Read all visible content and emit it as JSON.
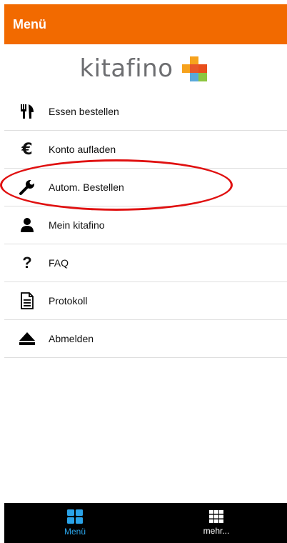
{
  "header": {
    "title": "Menü"
  },
  "logo": {
    "text": "kitafino"
  },
  "menu": {
    "items": [
      {
        "label": "Essen bestellen",
        "icon": "cutlery-icon"
      },
      {
        "label": "Konto aufladen",
        "icon": "euro-icon"
      },
      {
        "label": "Autom. Bestellen",
        "icon": "wrench-icon"
      },
      {
        "label": "Mein kitafino",
        "icon": "user-icon"
      },
      {
        "label": "FAQ",
        "icon": "question-icon"
      },
      {
        "label": "Protokoll",
        "icon": "document-icon"
      },
      {
        "label": "Abmelden",
        "icon": "eject-icon"
      }
    ]
  },
  "bottom_nav": {
    "tabs": [
      {
        "label": "Menü",
        "icon": "grid-icon",
        "active": true
      },
      {
        "label": "mehr...",
        "icon": "apps-icon",
        "active": false
      }
    ]
  },
  "colors": {
    "header_bg": "#f26a00",
    "active_tab": "#2aa3e8",
    "inactive_tab": "#ffffff",
    "highlight": "#e01010"
  }
}
